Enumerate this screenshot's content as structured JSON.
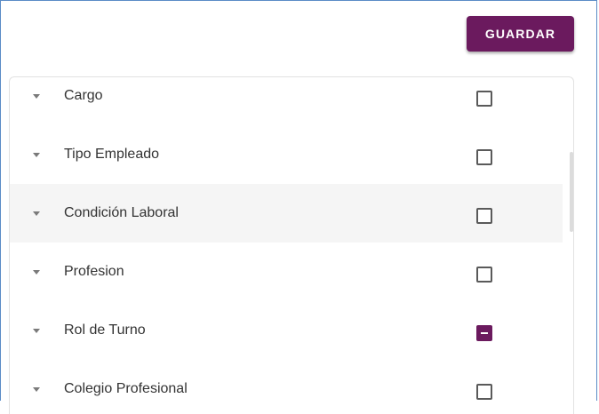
{
  "toolbar": {
    "save_label": "GUARDAR"
  },
  "colors": {
    "accent": "#6b1a5e",
    "frame_border": "#5b8cc6",
    "row_hover": "#f5f5f5"
  },
  "tree": {
    "items": [
      {
        "label": "Cargo",
        "icon": "caret-down-icon",
        "checkbox_state": "unchecked"
      },
      {
        "label": "Tipo Empleado",
        "icon": "caret-down-icon",
        "checkbox_state": "unchecked"
      },
      {
        "label": "Condición Laboral",
        "icon": "caret-down-icon",
        "checkbox_state": "unchecked",
        "highlighted": true
      },
      {
        "label": "Profesion",
        "icon": "caret-down-icon",
        "checkbox_state": "unchecked"
      },
      {
        "label": "Rol de Turno",
        "icon": "caret-down-icon",
        "checkbox_state": "indeterminate"
      },
      {
        "label": "Colegio Profesional",
        "icon": "caret-down-icon",
        "checkbox_state": "unchecked"
      }
    ]
  }
}
